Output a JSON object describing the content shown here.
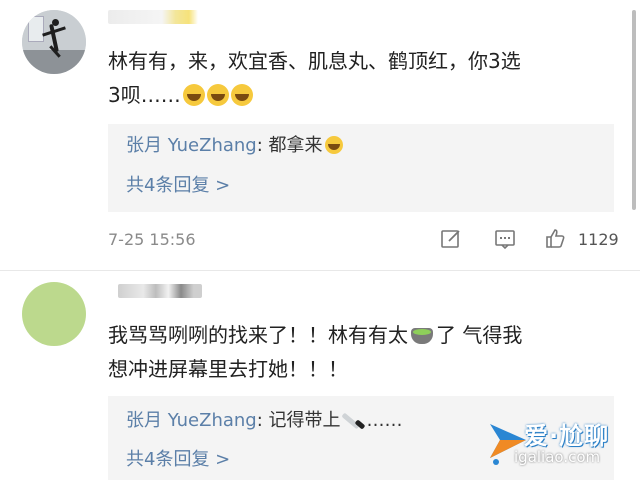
{
  "comments": [
    {
      "text_line1": "林有有，来，欢宜香、肌息丸、鹤顶红，你3选",
      "text_line2": "3呗……",
      "emojis": [
        "laugh-cry-emoji",
        "laugh-cry-emoji",
        "laugh-cry-emoji"
      ],
      "reply": {
        "author": "张月 YueZhang",
        "separator": ": ",
        "text": "都拿来",
        "emoji": "laugh-cry-emoji"
      },
      "reply_more": "共4条回复 >",
      "timestamp": "7-25 15:56",
      "like_count": "1129"
    },
    {
      "text_line1_a": "我骂骂咧咧的找来了！！林有有太",
      "text_line1_b": "了 气得我",
      "text_line2": "想冲进屏幕里去打她！！！",
      "inline_emoji": "tea-emoji",
      "reply": {
        "author": "张月 YueZhang",
        "separator": ": ",
        "text": "记得带上",
        "emoji": "knife-emoji",
        "trailing": "……"
      },
      "reply_more": "共4条回复 >"
    }
  ],
  "icons": [
    "edit-icon",
    "comment-icon",
    "like-icon"
  ],
  "watermark": {
    "title": "爱·尬聊",
    "url": "igaliao.com"
  }
}
